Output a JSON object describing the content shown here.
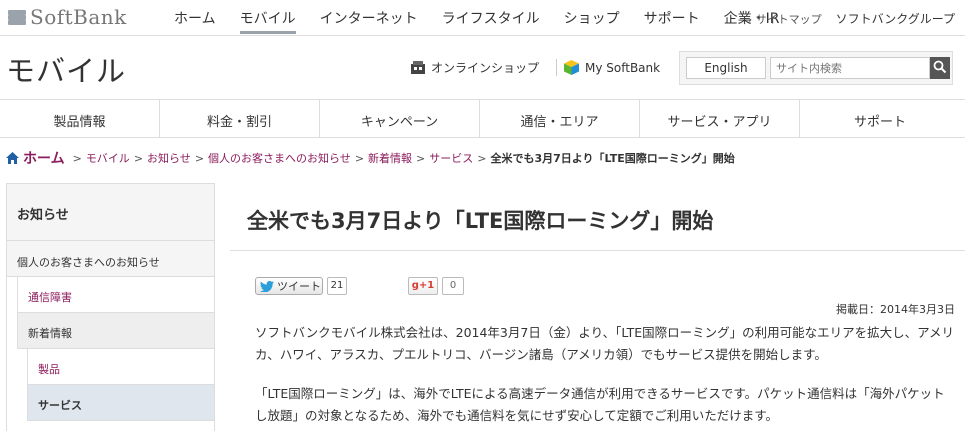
{
  "brand": {
    "name": "SoftBank"
  },
  "top_nav": {
    "items": [
      {
        "label": "ホーム",
        "active": false
      },
      {
        "label": "モバイル",
        "active": true
      },
      {
        "label": "インターネット",
        "active": false
      },
      {
        "label": "ライフスタイル",
        "active": false
      },
      {
        "label": "ショップ",
        "active": false
      },
      {
        "label": "サポート",
        "active": false
      },
      {
        "label": "企業・IR",
        "active": false
      }
    ],
    "sitemap_label": "› サイトマップ",
    "group_label": "ソフトバンクグループ"
  },
  "header": {
    "section_title": "モバイル",
    "online_shop_label": "オンラインショップ",
    "mysoftbank_label": "My SoftBank",
    "english_label": "English",
    "search_placeholder": "サイト内検索"
  },
  "global_nav": {
    "items": [
      {
        "label": "製品情報"
      },
      {
        "label": "料金・割引"
      },
      {
        "label": "キャンペーン"
      },
      {
        "label": "通信・エリア"
      },
      {
        "label": "サービス・アプリ"
      },
      {
        "label": "サポート"
      }
    ]
  },
  "breadcrumb": {
    "home": "ホーム",
    "links": [
      "モバイル",
      "お知らせ",
      "個人のお客さまへのお知らせ",
      "新着情報",
      "サービス"
    ],
    "separator": ">",
    "current": "全米でも3月7日より「LTE国際ローミング」開始"
  },
  "side_nav": {
    "heading": "お知らせ",
    "level1": "個人のお客さまへのお知らせ",
    "level2": [
      {
        "label": "通信障害",
        "type": "link"
      },
      {
        "label": "新着情報",
        "type": "plain"
      }
    ],
    "level3": [
      {
        "label": "製品",
        "type": "link"
      },
      {
        "label": "サービス",
        "type": "selected"
      }
    ]
  },
  "article": {
    "title": "全米でも3月7日より「LTE国際ローミング」開始",
    "tweet_label": "ツイート",
    "tweet_count": "21",
    "gplus_label": "g+1",
    "gplus_count": "0",
    "posted_date": "掲載日：2014年3月3日",
    "paragraph1": "ソフトバンクモバイル株式会社は、2014年3月7日（金）より、「LTE国際ローミング」の利用可能なエリアを拡大し、アメリカ、ハワイ、アラスカ、プエルトリコ、バージン諸島（アメリカ領）でもサービス提供を開始します。",
    "paragraph2": "「LTE国際ローミング」は、海外でLTEによる高速データ通信が利用できるサービスです。パケット通信料は「海外パケットし放題」の対象となるため、海外でも通信料を気にせず安心して定額でご利用いただけます。"
  },
  "colors": {
    "link": "#8c1c5c",
    "selected_bg": "#dfe6ee",
    "tweet_blue": "#2b9fd9"
  },
  "icons": [
    "softbank-logo-icon",
    "shop-icon",
    "cube-icon",
    "search-icon",
    "home-icon",
    "twitter-bird-icon"
  ]
}
